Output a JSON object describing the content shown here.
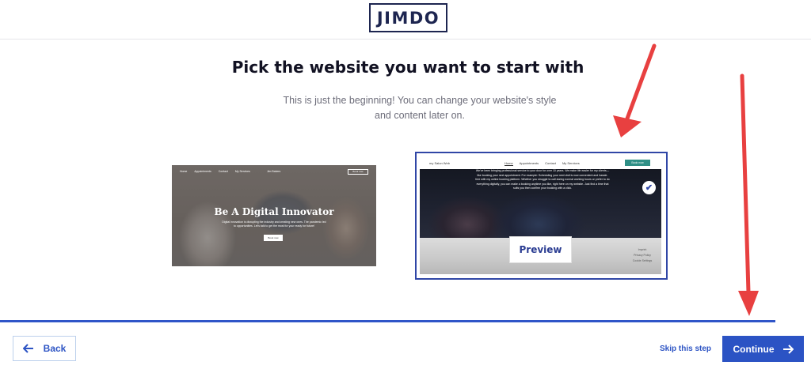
{
  "header": {
    "logo": "JIMDO"
  },
  "main": {
    "title": "Pick the website you want to start with",
    "subtitle_line1": "This is just the beginning! You can change your website's style",
    "subtitle_line2": "and content later on."
  },
  "templates": [
    {
      "nav": [
        "Home",
        "Appointments",
        "Contact",
        "My Services"
      ],
      "brand": "Jim Bakers",
      "top_button": "Book now",
      "hero": "Be A Digital Innovator",
      "lead": "Digital innovation is disrupting the industry and creating new ones. The pandemic led to opportunities. Let's talk to get the most for your ready for future!",
      "cta": "Book now"
    },
    {
      "site": "my Salon Web",
      "nav": [
        "Home",
        "Appointments",
        "Contact",
        "My Services"
      ],
      "book": "Book now",
      "paragraph": "We've been bringing professional service to your door for over 10 years. We make life easier for my clients—like booking your next appointment. For example: Scheduling your next visit is now convenient and hassle-free with my online booking platform. Whether you struggle to call during normal working hours or prefer to do everything digitally, you can make a booking anytime you like, right here on my website. Just find a time that suits you then confirm your booking with a click.",
      "footer_links": [
        "Imprint",
        "Privacy Policy",
        "Cookie Settings"
      ],
      "preview_label": "Preview",
      "selected": true
    }
  ],
  "progress": 0.956,
  "footer": {
    "back_label": "Back",
    "skip_label": "Skip this step",
    "continue_label": "Continue"
  },
  "colors": {
    "accent": "#2b53c4",
    "annotation_arrows": "#e84040"
  }
}
